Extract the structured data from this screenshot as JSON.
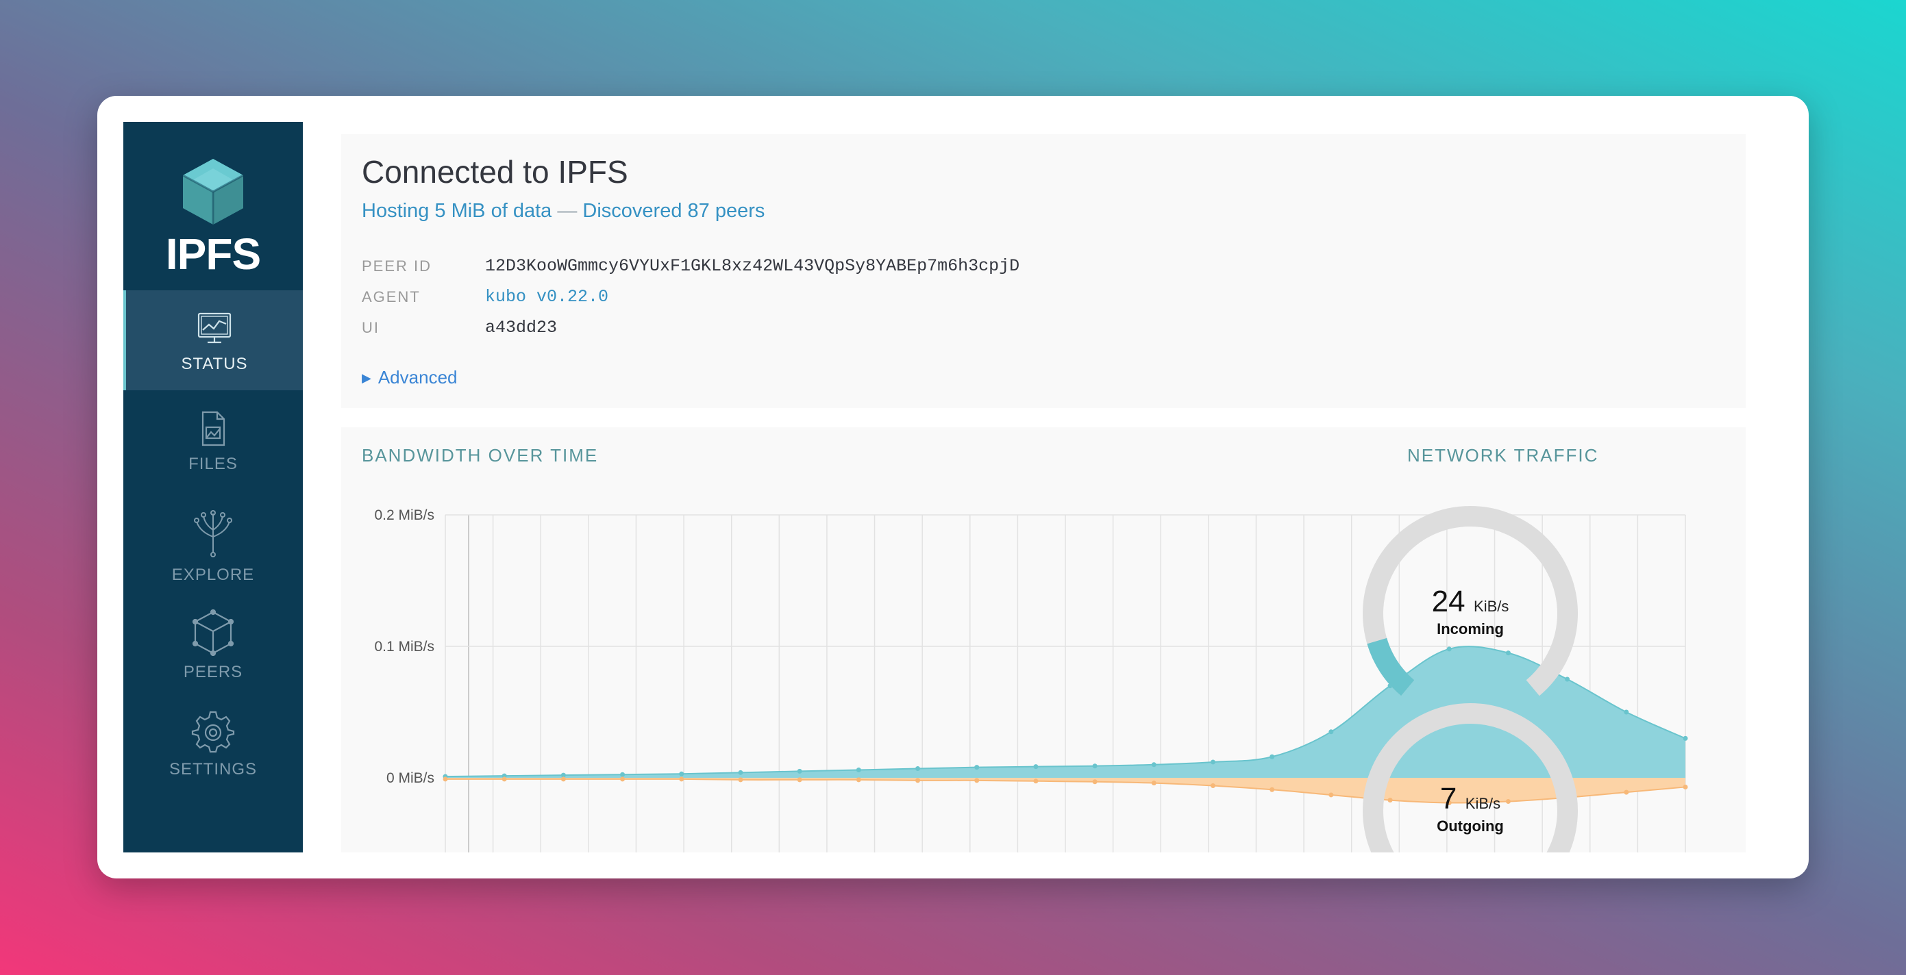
{
  "sidebar": {
    "logo_text": "IPFS",
    "items": [
      {
        "label": "STATUS",
        "icon": "status-monitor-icon",
        "active": true
      },
      {
        "label": "FILES",
        "icon": "files-document-icon",
        "active": false
      },
      {
        "label": "EXPLORE",
        "icon": "explore-tree-icon",
        "active": false
      },
      {
        "label": "PEERS",
        "icon": "peers-cube-icon",
        "active": false
      },
      {
        "label": "SETTINGS",
        "icon": "settings-gear-icon",
        "active": false
      }
    ]
  },
  "status": {
    "title": "Connected to IPFS",
    "hosting": "Hosting 5 MiB of data",
    "separator": "—",
    "discovered": "Discovered 87 peers",
    "details": [
      {
        "label": "PEER ID",
        "value": "12D3KooWGmmcy6VYUxF1GKL8xz42WL43VQpSy8YABEp7m6h3cpjD"
      },
      {
        "label": "AGENT",
        "value": "kubo v0.22.0"
      },
      {
        "label": "UI",
        "value": "a43dd23"
      }
    ],
    "advanced_label": "Advanced"
  },
  "bandwidth": {
    "title": "BANDWIDTH OVER TIME"
  },
  "traffic": {
    "title": "NETWORK TRAFFIC",
    "incoming": {
      "value": "24",
      "unit": "KiB/s",
      "label": "Incoming",
      "fraction": 0.12
    },
    "outgoing": {
      "value": "7",
      "unit": "KiB/s",
      "label": "Outgoing",
      "fraction": 0.04
    }
  },
  "colors": {
    "sidebar_bg": "#0b3a53",
    "incoming": "#69c4cd",
    "outgoing": "#f39031",
    "incoming_area": "#8ed3dc",
    "outgoing_area": "#fcd3a6",
    "gauge_track": "#dddddd"
  },
  "chart_data": {
    "type": "area",
    "y_tick_labels": [
      "0.2 MiB/s",
      "0.1 MiB/s",
      "0 MiB/s"
    ],
    "y_ticks": [
      0.2,
      0.1,
      0
    ],
    "ylim": [
      -0.05,
      0.2
    ],
    "grid": true,
    "series": [
      {
        "name": "Incoming",
        "values": [
          0.001,
          0.0015,
          0.002,
          0.0025,
          0.003,
          0.004,
          0.005,
          0.006,
          0.007,
          0.008,
          0.0085,
          0.009,
          0.01,
          0.012,
          0.016,
          0.035,
          0.07,
          0.098,
          0.095,
          0.075,
          0.05,
          0.03
        ]
      },
      {
        "name": "Outgoing",
        "values": [
          -0.001,
          -0.001,
          -0.001,
          -0.001,
          -0.001,
          -0.0015,
          -0.0015,
          -0.0015,
          -0.002,
          -0.002,
          -0.0025,
          -0.003,
          -0.004,
          -0.006,
          -0.009,
          -0.013,
          -0.017,
          -0.019,
          -0.018,
          -0.015,
          -0.011,
          -0.007
        ]
      }
    ]
  }
}
